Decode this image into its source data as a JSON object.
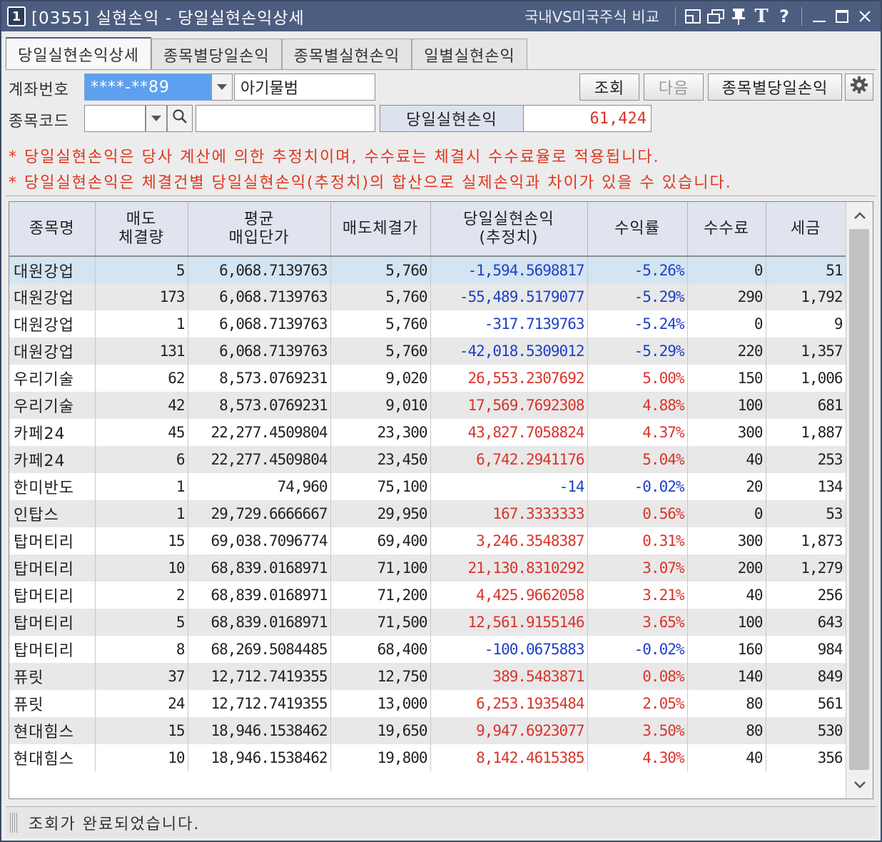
{
  "window": {
    "number": "1",
    "title": "[0355] 실현손익 - 당일실현손익상세",
    "compare_link": "국내VS미국주식 비교"
  },
  "tabs": [
    "당일실현손익상세",
    "종목별당일손익",
    "종목별실현손익",
    "일별실현손익"
  ],
  "form": {
    "account_label": "계좌번호",
    "account_value": "****-**89",
    "account_name": "아기물범",
    "code_label": "종목코드",
    "code_value": "",
    "code_name": "",
    "query_button": "조회",
    "next_button": "다음",
    "by_stock_button": "종목별당일손익",
    "summary_label": "당일실현손익",
    "summary_value": "61,424"
  },
  "notices": [
    "* 당일실현손익은 당사 계산에 의한 추정치이며, 수수료는 체결시 수수료율로 적용됩니다.",
    "* 당일실현손익은 체결건별 당일실현손익(추정치)의 합산으로 실제손익과 차이가 있을 수 있습니다."
  ],
  "table": {
    "headers": [
      [
        "종목명"
      ],
      [
        "매도",
        "체결량"
      ],
      [
        "평균",
        "매입단가"
      ],
      [
        "매도체결가"
      ],
      [
        "당일실현손익",
        "(추정치)"
      ],
      [
        "수익률"
      ],
      [
        "수수료"
      ],
      [
        "세금"
      ]
    ],
    "rows": [
      {
        "name": "대원강업",
        "qty": "5",
        "avg": "6,068.7139763",
        "sell": "5,760",
        "pnl": "-1,594.5698817",
        "rate": "-5.26%",
        "fee": "0",
        "tax": "51",
        "sign": "neg"
      },
      {
        "name": "대원강업",
        "qty": "173",
        "avg": "6,068.7139763",
        "sell": "5,760",
        "pnl": "-55,489.5179077",
        "rate": "-5.29%",
        "fee": "290",
        "tax": "1,792",
        "sign": "neg"
      },
      {
        "name": "대원강업",
        "qty": "1",
        "avg": "6,068.7139763",
        "sell": "5,760",
        "pnl": "-317.7139763",
        "rate": "-5.24%",
        "fee": "0",
        "tax": "9",
        "sign": "neg"
      },
      {
        "name": "대원강업",
        "qty": "131",
        "avg": "6,068.7139763",
        "sell": "5,760",
        "pnl": "-42,018.5309012",
        "rate": "-5.29%",
        "fee": "220",
        "tax": "1,357",
        "sign": "neg"
      },
      {
        "name": "우리기술",
        "qty": "62",
        "avg": "8,573.0769231",
        "sell": "9,020",
        "pnl": "26,553.2307692",
        "rate": "5.00%",
        "fee": "150",
        "tax": "1,006",
        "sign": "pos"
      },
      {
        "name": "우리기술",
        "qty": "42",
        "avg": "8,573.0769231",
        "sell": "9,010",
        "pnl": "17,569.7692308",
        "rate": "4.88%",
        "fee": "100",
        "tax": "681",
        "sign": "pos"
      },
      {
        "name": "카페24",
        "qty": "45",
        "avg": "22,277.4509804",
        "sell": "23,300",
        "pnl": "43,827.7058824",
        "rate": "4.37%",
        "fee": "300",
        "tax": "1,887",
        "sign": "pos"
      },
      {
        "name": "카페24",
        "qty": "6",
        "avg": "22,277.4509804",
        "sell": "23,450",
        "pnl": "6,742.2941176",
        "rate": "5.04%",
        "fee": "40",
        "tax": "253",
        "sign": "pos"
      },
      {
        "name": "한미반도",
        "qty": "1",
        "avg": "74,960",
        "sell": "75,100",
        "pnl": "-14",
        "rate": "-0.02%",
        "fee": "20",
        "tax": "134",
        "sign": "neg"
      },
      {
        "name": "인탑스",
        "qty": "1",
        "avg": "29,729.6666667",
        "sell": "29,950",
        "pnl": "167.3333333",
        "rate": "0.56%",
        "fee": "0",
        "tax": "53",
        "sign": "pos"
      },
      {
        "name": "탑머티리",
        "qty": "15",
        "avg": "69,038.7096774",
        "sell": "69,400",
        "pnl": "3,246.3548387",
        "rate": "0.31%",
        "fee": "300",
        "tax": "1,873",
        "sign": "pos"
      },
      {
        "name": "탑머티리",
        "qty": "10",
        "avg": "68,839.0168971",
        "sell": "71,100",
        "pnl": "21,130.8310292",
        "rate": "3.07%",
        "fee": "200",
        "tax": "1,279",
        "sign": "pos"
      },
      {
        "name": "탑머티리",
        "qty": "2",
        "avg": "68,839.0168971",
        "sell": "71,200",
        "pnl": "4,425.9662058",
        "rate": "3.21%",
        "fee": "40",
        "tax": "256",
        "sign": "pos"
      },
      {
        "name": "탑머티리",
        "qty": "5",
        "avg": "68,839.0168971",
        "sell": "71,500",
        "pnl": "12,561.9155146",
        "rate": "3.65%",
        "fee": "100",
        "tax": "643",
        "sign": "pos"
      },
      {
        "name": "탑머티리",
        "qty": "8",
        "avg": "68,269.5084485",
        "sell": "68,400",
        "pnl": "-100.0675883",
        "rate": "-0.02%",
        "fee": "160",
        "tax": "984",
        "sign": "neg"
      },
      {
        "name": "퓨릿",
        "qty": "37",
        "avg": "12,712.7419355",
        "sell": "12,750",
        "pnl": "389.5483871",
        "rate": "0.08%",
        "fee": "140",
        "tax": "849",
        "sign": "pos"
      },
      {
        "name": "퓨릿",
        "qty": "24",
        "avg": "12,712.7419355",
        "sell": "13,000",
        "pnl": "6,253.1935484",
        "rate": "2.05%",
        "fee": "80",
        "tax": "561",
        "sign": "pos"
      },
      {
        "name": "현대힘스",
        "qty": "15",
        "avg": "18,946.1538462",
        "sell": "19,650",
        "pnl": "9,947.6923077",
        "rate": "3.50%",
        "fee": "80",
        "tax": "530",
        "sign": "pos"
      },
      {
        "name": "현대힘스",
        "qty": "10",
        "avg": "18,946.1538462",
        "sell": "19,800",
        "pnl": "8,142.4615385",
        "rate": "4.30%",
        "fee": "40",
        "tax": "356",
        "sign": "pos"
      }
    ]
  },
  "status": "조회가 완료되었습니다.",
  "colors": {
    "title_bar": "#4c5d80",
    "negative": "#1f40c8",
    "positive": "#d9342b",
    "notice": "#e0361e",
    "selected_row": "#d3e4f2"
  },
  "icons": [
    "restore-icon",
    "cascade-icon",
    "pin-icon",
    "text-size-icon",
    "help-icon",
    "minimize-icon",
    "maximize-icon",
    "close-icon",
    "dropdown-icon",
    "search-icon",
    "settings-gear-icon",
    "scroll-up-icon",
    "scroll-down-icon"
  ]
}
